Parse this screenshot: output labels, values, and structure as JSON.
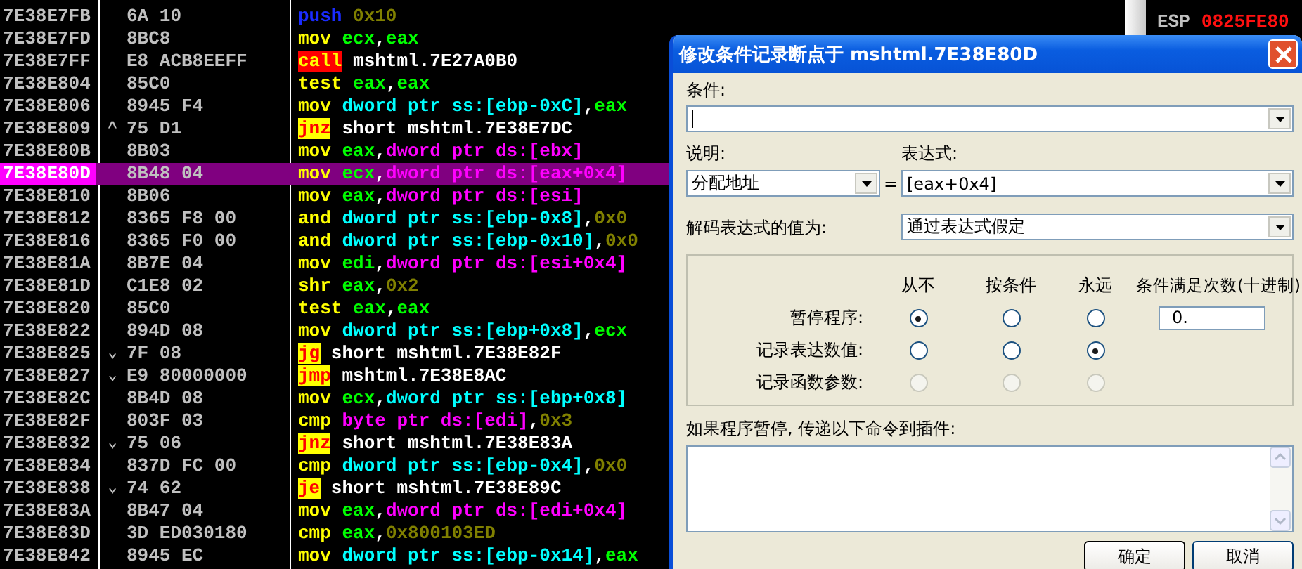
{
  "disassembly": {
    "rows": [
      {
        "address": "7E38E7FB",
        "jump_mark": "",
        "hex": "6A 10",
        "mnemonic": "push",
        "kind": "push",
        "selected": false,
        "operands": [
          {
            "text": "0x10",
            "kind": "imm"
          }
        ]
      },
      {
        "address": "7E38E7FD",
        "jump_mark": "",
        "hex": "8BC8",
        "mnemonic": "mov",
        "kind": "plain",
        "selected": false,
        "operands": [
          {
            "text": "ecx",
            "kind": "reg"
          },
          {
            "text": ",",
            "kind": "sep"
          },
          {
            "text": "eax",
            "kind": "reg"
          }
        ]
      },
      {
        "address": "7E38E7FF",
        "jump_mark": "",
        "hex": "E8 ACB8EEFF",
        "mnemonic": "call",
        "kind": "call",
        "selected": false,
        "operands": [
          {
            "text": "mshtml.7E27A0B0",
            "kind": "label"
          }
        ]
      },
      {
        "address": "7E38E804",
        "jump_mark": "",
        "hex": "85C0",
        "mnemonic": "test",
        "kind": "plain",
        "selected": false,
        "operands": [
          {
            "text": "eax",
            "kind": "reg"
          },
          {
            "text": ",",
            "kind": "sep"
          },
          {
            "text": "eax",
            "kind": "reg"
          }
        ]
      },
      {
        "address": "7E38E806",
        "jump_mark": "",
        "hex": "8945 F4",
        "mnemonic": "mov",
        "kind": "plain",
        "selected": false,
        "operands": [
          {
            "text": "dword ptr ss:[ebp-0xC]",
            "kind": "stack"
          },
          {
            "text": ",",
            "kind": "sep"
          },
          {
            "text": "eax",
            "kind": "reg"
          }
        ]
      },
      {
        "address": "7E38E809",
        "jump_mark": "^",
        "hex": "75 D1",
        "mnemonic": "jnz",
        "kind": "jump",
        "selected": false,
        "operands": [
          {
            "text": "short mshtml.7E38E7DC",
            "kind": "label"
          }
        ]
      },
      {
        "address": "7E38E80B",
        "jump_mark": "",
        "hex": "8B03",
        "mnemonic": "mov",
        "kind": "plain",
        "selected": false,
        "operands": [
          {
            "text": "eax",
            "kind": "reg"
          },
          {
            "text": ",",
            "kind": "sep"
          },
          {
            "text": "dword ptr ds:[ebx]",
            "kind": "data"
          }
        ]
      },
      {
        "address": "7E38E80D",
        "jump_mark": "",
        "hex": "8B48 04",
        "mnemonic": "mov",
        "kind": "plain",
        "selected": true,
        "operands": [
          {
            "text": "ecx",
            "kind": "reg"
          },
          {
            "text": ",",
            "kind": "sep"
          },
          {
            "text": "dword ptr ds:[eax+0x4]",
            "kind": "data"
          }
        ]
      },
      {
        "address": "7E38E810",
        "jump_mark": "",
        "hex": "8B06",
        "mnemonic": "mov",
        "kind": "plain",
        "selected": false,
        "operands": [
          {
            "text": "eax",
            "kind": "reg"
          },
          {
            "text": ",",
            "kind": "sep"
          },
          {
            "text": "dword ptr ds:[esi]",
            "kind": "data"
          }
        ]
      },
      {
        "address": "7E38E812",
        "jump_mark": "",
        "hex": "8365 F8 00",
        "mnemonic": "and",
        "kind": "plain",
        "selected": false,
        "operands": [
          {
            "text": "dword ptr ss:[ebp-0x8]",
            "kind": "stack"
          },
          {
            "text": ",",
            "kind": "sep"
          },
          {
            "text": "0x0",
            "kind": "imm"
          }
        ]
      },
      {
        "address": "7E38E816",
        "jump_mark": "",
        "hex": "8365 F0 00",
        "mnemonic": "and",
        "kind": "plain",
        "selected": false,
        "operands": [
          {
            "text": "dword ptr ss:[ebp-0x10]",
            "kind": "stack"
          },
          {
            "text": ",",
            "kind": "sep"
          },
          {
            "text": "0x0",
            "kind": "imm"
          }
        ]
      },
      {
        "address": "7E38E81A",
        "jump_mark": "",
        "hex": "8B7E 04",
        "mnemonic": "mov",
        "kind": "plain",
        "selected": false,
        "operands": [
          {
            "text": "edi",
            "kind": "reg"
          },
          {
            "text": ",",
            "kind": "sep"
          },
          {
            "text": "dword ptr ds:[esi+0x4]",
            "kind": "data"
          }
        ]
      },
      {
        "address": "7E38E81D",
        "jump_mark": "",
        "hex": "C1E8 02",
        "mnemonic": "shr",
        "kind": "plain",
        "selected": false,
        "operands": [
          {
            "text": "eax",
            "kind": "reg"
          },
          {
            "text": ",",
            "kind": "sep"
          },
          {
            "text": "0x2",
            "kind": "imm"
          }
        ]
      },
      {
        "address": "7E38E820",
        "jump_mark": "",
        "hex": "85C0",
        "mnemonic": "test",
        "kind": "plain",
        "selected": false,
        "operands": [
          {
            "text": "eax",
            "kind": "reg"
          },
          {
            "text": ",",
            "kind": "sep"
          },
          {
            "text": "eax",
            "kind": "reg"
          }
        ]
      },
      {
        "address": "7E38E822",
        "jump_mark": "",
        "hex": "894D 08",
        "mnemonic": "mov",
        "kind": "plain",
        "selected": false,
        "operands": [
          {
            "text": "dword ptr ss:[ebp+0x8]",
            "kind": "stack"
          },
          {
            "text": ",",
            "kind": "sep"
          },
          {
            "text": "ecx",
            "kind": "reg"
          }
        ]
      },
      {
        "address": "7E38E825",
        "jump_mark": "⌄",
        "hex": "7F 08",
        "mnemonic": "jg",
        "kind": "jump",
        "selected": false,
        "operands": [
          {
            "text": "short mshtml.7E38E82F",
            "kind": "label"
          }
        ]
      },
      {
        "address": "7E38E827",
        "jump_mark": "⌄",
        "hex": "E9 80000000",
        "mnemonic": "jmp",
        "kind": "jump",
        "selected": false,
        "operands": [
          {
            "text": "mshtml.7E38E8AC",
            "kind": "label"
          }
        ]
      },
      {
        "address": "7E38E82C",
        "jump_mark": "",
        "hex": "8B4D 08",
        "mnemonic": "mov",
        "kind": "plain",
        "selected": false,
        "operands": [
          {
            "text": "ecx",
            "kind": "reg"
          },
          {
            "text": ",",
            "kind": "sep"
          },
          {
            "text": "dword ptr ss:[ebp+0x8]",
            "kind": "stack"
          }
        ]
      },
      {
        "address": "7E38E82F",
        "jump_mark": "",
        "hex": "803F 03",
        "mnemonic": "cmp",
        "kind": "plain",
        "selected": false,
        "operands": [
          {
            "text": "byte ptr ds:[edi]",
            "kind": "data"
          },
          {
            "text": ",",
            "kind": "sep"
          },
          {
            "text": "0x3",
            "kind": "imm"
          }
        ]
      },
      {
        "address": "7E38E832",
        "jump_mark": "⌄",
        "hex": "75 06",
        "mnemonic": "jnz",
        "kind": "jump",
        "selected": false,
        "operands": [
          {
            "text": "short mshtml.7E38E83A",
            "kind": "label"
          }
        ]
      },
      {
        "address": "7E38E834",
        "jump_mark": "",
        "hex": "837D FC 00",
        "mnemonic": "cmp",
        "kind": "plain",
        "selected": false,
        "operands": [
          {
            "text": "dword ptr ss:[ebp-0x4]",
            "kind": "stack"
          },
          {
            "text": ",",
            "kind": "sep"
          },
          {
            "text": "0x0",
            "kind": "imm"
          }
        ]
      },
      {
        "address": "7E38E838",
        "jump_mark": "⌄",
        "hex": "74 62",
        "mnemonic": "je",
        "kind": "jump",
        "selected": false,
        "operands": [
          {
            "text": "short mshtml.7E38E89C",
            "kind": "label"
          }
        ]
      },
      {
        "address": "7E38E83A",
        "jump_mark": "",
        "hex": "8B47 04",
        "mnemonic": "mov",
        "kind": "plain",
        "selected": false,
        "operands": [
          {
            "text": "eax",
            "kind": "reg"
          },
          {
            "text": ",",
            "kind": "sep"
          },
          {
            "text": "dword ptr ds:[edi+0x4]",
            "kind": "data"
          }
        ]
      },
      {
        "address": "7E38E83D",
        "jump_mark": "",
        "hex": "3D ED030180",
        "mnemonic": "cmp",
        "kind": "plain",
        "selected": false,
        "operands": [
          {
            "text": "eax",
            "kind": "reg"
          },
          {
            "text": ",",
            "kind": "sep"
          },
          {
            "text": "0x800103ED",
            "kind": "imm"
          }
        ]
      },
      {
        "address": "7E38E842",
        "jump_mark": "",
        "hex": "8945 EC",
        "mnemonic": "mov",
        "kind": "plain",
        "selected": false,
        "operands": [
          {
            "text": "dword ptr ss:[ebp-0x14]",
            "kind": "stack"
          },
          {
            "text": ",",
            "kind": "sep"
          },
          {
            "text": "eax",
            "kind": "reg"
          }
        ]
      }
    ]
  },
  "registers": [
    {
      "name": "ESP",
      "value": "0825FE80"
    }
  ],
  "dialog": {
    "title": "修改条件记录断点于 mshtml.7E38E80D",
    "condition": {
      "label": "条件:"
    },
    "description": {
      "label": "说明:",
      "value": "分配地址"
    },
    "equals": "=",
    "expression": {
      "label": "表达式:",
      "value": "[eax+0x4]"
    },
    "decode": {
      "label": "解码表达式的值为:",
      "value": "通过表达式假定"
    },
    "columns": [
      "从不",
      "按条件",
      "永远",
      "条件满足次数(十进制)"
    ],
    "radio_rows": [
      {
        "label": "暂停程序:",
        "disabled": false,
        "options": [
          {
            "selected": true
          },
          {
            "selected": false
          },
          {
            "selected": false
          }
        ]
      },
      {
        "label": "记录表达数值:",
        "disabled": false,
        "options": [
          {
            "selected": false
          },
          {
            "selected": false
          },
          {
            "selected": true
          }
        ]
      },
      {
        "label": "记录函数参数:",
        "disabled": true,
        "options": [
          {
            "selected": false
          },
          {
            "selected": false
          },
          {
            "selected": false
          }
        ]
      }
    ],
    "pass_count": {
      "value": "0."
    },
    "plugin_commands": {
      "label": "如果程序暂停, 传递以下命令到插件:"
    },
    "buttons": [
      "确定",
      "取消"
    ]
  }
}
